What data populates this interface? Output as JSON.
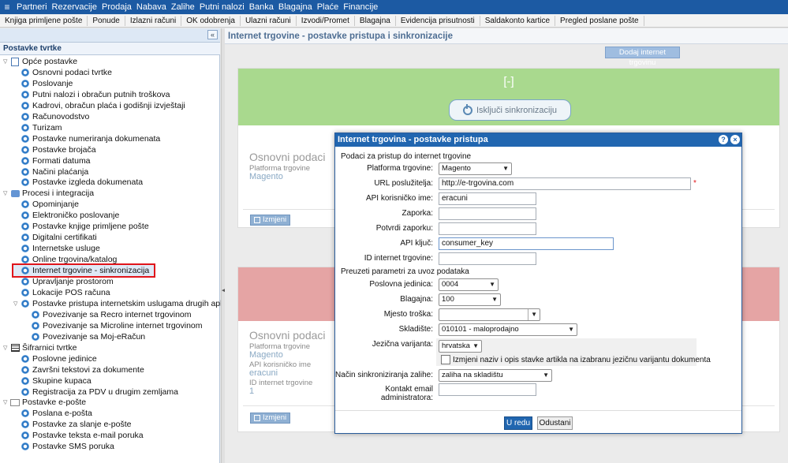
{
  "top_menu": [
    "Partneri",
    "Rezervacije",
    "Prodaja",
    "Nabava",
    "Zalihe",
    "Putni nalozi",
    "Banka",
    "Blagajna",
    "Plaće",
    "Financije"
  ],
  "sub_toolbar": [
    "Knjiga primljene pošte",
    "Ponude",
    "Izlazni računi",
    "OK odobrenja",
    "Ulazni računi",
    "Izvodi/Promet",
    "Blagajna",
    "Evidencija prisutnosti",
    "Saldakonto kartice",
    "Pregled poslane pošte"
  ],
  "left_panel": {
    "collapse_glyph": "«",
    "title": "Postavke tvrtke",
    "tree": [
      {
        "label": "Opće postavke",
        "level": 0,
        "icon": "folder-doc-icon",
        "expanded": true
      },
      {
        "label": "Osnovni podaci tvrtke",
        "level": 1,
        "icon": "gear-icon"
      },
      {
        "label": "Poslovanje",
        "level": 1,
        "icon": "gear-icon"
      },
      {
        "label": "Putni nalozi i obračun putnih troškova",
        "level": 1,
        "icon": "gear-icon"
      },
      {
        "label": "Kadrovi, obračun plaća i godišnji izvještaji",
        "level": 1,
        "icon": "gear-icon"
      },
      {
        "label": "Računovodstvo",
        "level": 1,
        "icon": "gear-icon"
      },
      {
        "label": "Turizam",
        "level": 1,
        "icon": "gear-icon"
      },
      {
        "label": "Postavke numeriranja dokumenata",
        "level": 1,
        "icon": "gear-icon"
      },
      {
        "label": "Postavke brojača",
        "level": 1,
        "icon": "gear-icon"
      },
      {
        "label": "Formati datuma",
        "level": 1,
        "icon": "gear-icon"
      },
      {
        "label": "Načini plaćanja",
        "level": 1,
        "icon": "gear-icon"
      },
      {
        "label": "Postavke izgleda dokumenata",
        "level": 1,
        "icon": "gear-icon"
      },
      {
        "label": "Procesi i integracija",
        "level": 0,
        "icon": "puzzle-icon",
        "expanded": true
      },
      {
        "label": "Opominjanje",
        "level": 1,
        "icon": "gear-icon"
      },
      {
        "label": "Elektroničko poslovanje",
        "level": 1,
        "icon": "gear-icon"
      },
      {
        "label": "Postavke knjige primljene pošte",
        "level": 1,
        "icon": "gear-icon"
      },
      {
        "label": "Digitalni certifikati",
        "level": 1,
        "icon": "gear-icon"
      },
      {
        "label": "Internetske usluge",
        "level": 1,
        "icon": "gear-icon"
      },
      {
        "label": "Online trgovina/katalog",
        "level": 1,
        "icon": "gear-icon"
      },
      {
        "label": "Internet trgovine - sinkronizacija",
        "level": 1,
        "icon": "gear-icon",
        "selected": true
      },
      {
        "label": "Upravljanje prostorom",
        "level": 1,
        "icon": "gear-icon"
      },
      {
        "label": "Lokacije POS računa",
        "level": 1,
        "icon": "gear-icon"
      },
      {
        "label": "Postavke pristupa internetskim uslugama drugih aplikacija",
        "level": 1,
        "icon": "gear-icon",
        "expanded": true
      },
      {
        "label": "Povezivanje sa Recro internet trgovinom",
        "level": 2,
        "icon": "gear-icon"
      },
      {
        "label": "Povezivanje sa Microline internet trgovinom",
        "level": 2,
        "icon": "gear-icon"
      },
      {
        "label": "Povezivanje sa Moj-eRačun",
        "level": 2,
        "icon": "gear-icon"
      },
      {
        "label": "Šifrarnici tvrtke",
        "level": 0,
        "icon": "grid-icon",
        "expanded": true
      },
      {
        "label": "Poslovne jedinice",
        "level": 1,
        "icon": "gear-icon"
      },
      {
        "label": "Završni tekstovi za dokumente",
        "level": 1,
        "icon": "gear-icon"
      },
      {
        "label": "Skupine kupaca",
        "level": 1,
        "icon": "gear-icon"
      },
      {
        "label": "Registracija za PDV u drugim zemljama",
        "level": 1,
        "icon": "gear-icon"
      },
      {
        "label": "Postavke e-pošte",
        "level": 0,
        "icon": "mail-icon",
        "expanded": true
      },
      {
        "label": "Poslana e-pošta",
        "level": 1,
        "icon": "gear-icon"
      },
      {
        "label": "Postavke za slanje e-pošte",
        "level": 1,
        "icon": "gear-icon"
      },
      {
        "label": "Postavke teksta e-mail poruka",
        "level": 1,
        "icon": "gear-icon"
      },
      {
        "label": "Postavke SMS poruka",
        "level": 1,
        "icon": "gear-icon"
      }
    ]
  },
  "main": {
    "title": "Internet trgovine - postavke pristupa i sinkronizacije",
    "add_button": "Dodaj internet trgovinu",
    "card1": {
      "bracket": "[-]",
      "sync_button": "Isključi sinkronizaciju",
      "heading": "Osnovni podaci",
      "platform_label": "Platforma trgovine",
      "platform_value": "Magento",
      "edit_button": "Izmjeni"
    },
    "card2": {
      "heading": "Osnovni podaci",
      "platform_label": "Platforma trgovine",
      "platform_value": "Magento",
      "user_label": "API korisničko ime",
      "user_value": "eracuni",
      "id_label": "ID internet trgovine",
      "id_value": "1",
      "edit_button": "Izmjeni"
    }
  },
  "modal": {
    "title": "Internet trgovina - postavke pristupa",
    "help_glyph": "?",
    "close_glyph": "×",
    "section1": "Podaci za pristup do internet trgovine",
    "platform_label": "Platforma trgovine:",
    "platform_value": "Magento",
    "url_label": "URL poslužitelja:",
    "url_value": "http://e-trgovina.com",
    "required_mark": "*",
    "api_user_label": "API korisničko ime:",
    "api_user_value": "eracuni",
    "password_label": "Zaporka:",
    "password_value": "",
    "password_confirm_label": "Potvrdi zaporku:",
    "password_confirm_value": "",
    "api_key_label": "API ključ:",
    "api_key_value": "consumer_key",
    "shop_id_label": "ID internet trgovine:",
    "shop_id_value": "",
    "section2": "Preuzeti parametri za uvoz podataka",
    "business_unit_label": "Poslovna jedinica:",
    "business_unit_value": "0004",
    "cash_label": "Blagajna:",
    "cash_value": "100",
    "cost_place_label": "Mjesto troška:",
    "cost_place_value": "",
    "warehouse_label": "Skladište:",
    "warehouse_value": "010101 - maloprodajno",
    "language_label": "Jezična varijanta:",
    "language_value": "hrvatska",
    "language_checkbox_label": "Izmjeni naziv i opis stavke artikla na izabranu jezičnu varijantu dokumenta",
    "sync_mode_label": "Način sinkroniziranja zalihe:",
    "sync_mode_value": "zaliha na skladištu",
    "admin_email_label": "Kontakt email administratora:",
    "admin_email_value": "",
    "ok_button": "U redu",
    "cancel_button": "Odustani"
  }
}
